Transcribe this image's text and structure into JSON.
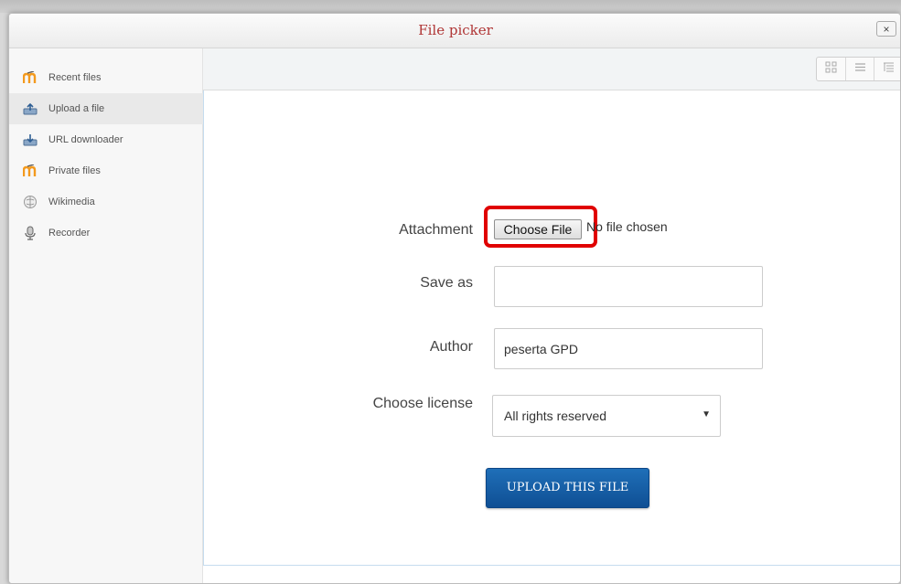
{
  "dialog": {
    "title": "File picker",
    "close_label": "×"
  },
  "sidebar": {
    "items": [
      {
        "label": "Recent files",
        "icon": "moodle-icon"
      },
      {
        "label": "Upload a file",
        "icon": "upload-icon"
      },
      {
        "label": "URL downloader",
        "icon": "download-icon"
      },
      {
        "label": "Private files",
        "icon": "moodle-icon"
      },
      {
        "label": "Wikimedia",
        "icon": "wikimedia-icon"
      },
      {
        "label": "Recorder",
        "icon": "microphone-icon"
      }
    ],
    "active_index": 1
  },
  "toolbar": {
    "views": [
      "icon-view",
      "list-view",
      "tree-view"
    ]
  },
  "form": {
    "attachment_label": "Attachment",
    "choose_file_label": "Choose File",
    "no_file_text": "No file chosen",
    "save_as_label": "Save as",
    "save_as_value": "",
    "author_label": "Author",
    "author_value": "peserta GPD",
    "license_label": "Choose license",
    "license_value": "All rights reserved",
    "upload_label": "UPLOAD THIS FILE"
  },
  "colors": {
    "title": "#b03636",
    "highlight": "#e00000",
    "upload_button": "#1a5fa8"
  }
}
